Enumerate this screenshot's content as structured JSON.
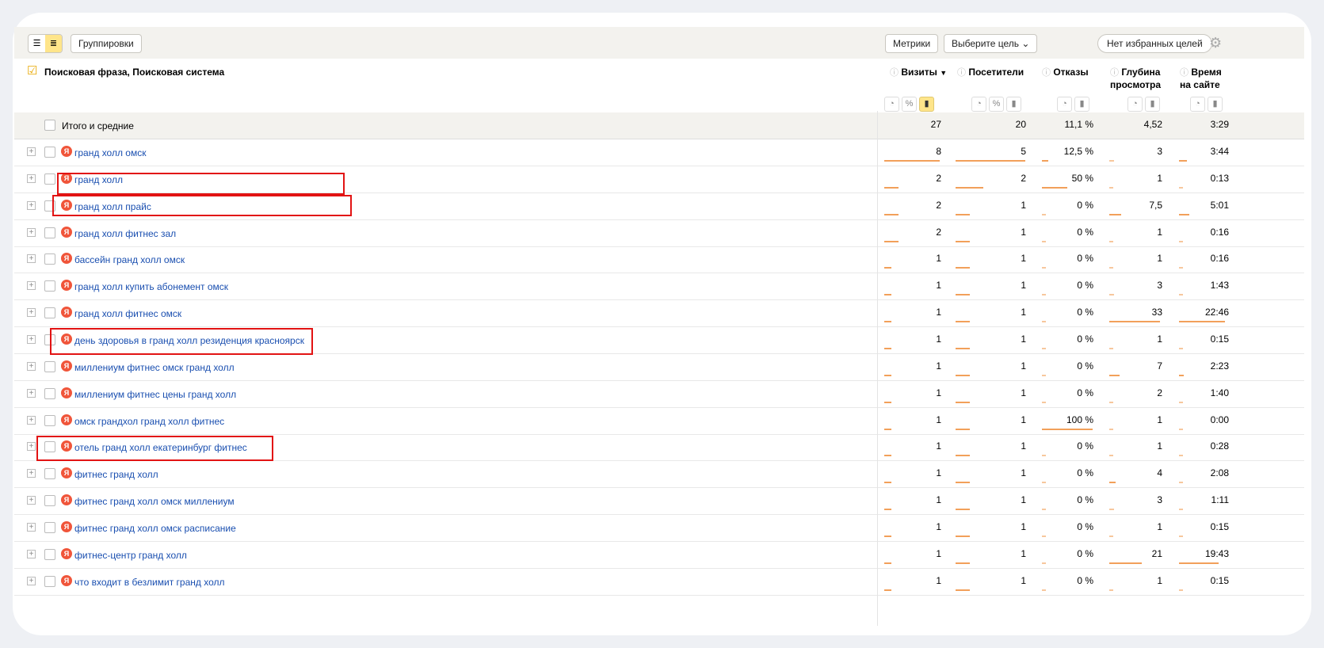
{
  "toolbar": {
    "groupings_label": "Группировки",
    "metrics_label": "Метрики",
    "goal_select_label": "Выберите цель",
    "favorites_label": "Нет избранных целей",
    "view_list_icon": "list-icon",
    "view_tree_icon": "tree-icon",
    "gear_icon": "gear-icon"
  },
  "header": {
    "dimension": "Поисковая фраза, Поисковая система",
    "columns": {
      "visits": "Визиты",
      "visitors": "Посетители",
      "bounces": "Отказы",
      "depth_1": "Глубина",
      "depth_2": "просмотра",
      "time_1": "Время",
      "time_2": "на сайте"
    },
    "sort_indicator": "▼"
  },
  "totals": {
    "label": "Итого и средние",
    "visits": "27",
    "visitors": "20",
    "bounces": "11,1 %",
    "depth": "4,52",
    "time": "3:29"
  },
  "rows": [
    {
      "phrase": "гранд холл омск",
      "visits": "8",
      "visitors": "5",
      "bounces": "12,5 %",
      "depth": "3",
      "time": "3:44",
      "f": [
        1,
        1,
        0.125,
        0.09,
        0.17
      ]
    },
    {
      "phrase": "гранд холл",
      "visits": "2",
      "visitors": "2",
      "bounces": "50 %",
      "depth": "1",
      "time": "0:13",
      "f": [
        0.25,
        0.4,
        0.5,
        0.03,
        0.01
      ]
    },
    {
      "phrase": "гранд холл прайс",
      "visits": "2",
      "visitors": "1",
      "bounces": "0 %",
      "depth": "7,5",
      "time": "5:01",
      "f": [
        0.25,
        0.2,
        0,
        0.23,
        0.22
      ]
    },
    {
      "phrase": "гранд холл фитнес зал",
      "visits": "2",
      "visitors": "1",
      "bounces": "0 %",
      "depth": "1",
      "time": "0:16",
      "f": [
        0.25,
        0.2,
        0,
        0.03,
        0.01
      ]
    },
    {
      "phrase": "бассейн гранд холл омск",
      "visits": "1",
      "visitors": "1",
      "bounces": "0 %",
      "depth": "1",
      "time": "0:16",
      "f": [
        0.13,
        0.2,
        0,
        0.03,
        0.01
      ]
    },
    {
      "phrase": "гранд холл купить абонемент омск",
      "visits": "1",
      "visitors": "1",
      "bounces": "0 %",
      "depth": "3",
      "time": "1:43",
      "f": [
        0.13,
        0.2,
        0,
        0.09,
        0.08
      ]
    },
    {
      "phrase": "гранд холл фитнес омск",
      "visits": "1",
      "visitors": "1",
      "bounces": "0 %",
      "depth": "33",
      "time": "22:46",
      "f": [
        0.13,
        0.2,
        0,
        1,
        1
      ]
    },
    {
      "phrase": "день здоровья в гранд холл резиденция красноярск",
      "visits": "1",
      "visitors": "1",
      "bounces": "0 %",
      "depth": "1",
      "time": "0:15",
      "f": [
        0.13,
        0.2,
        0,
        0.03,
        0.01
      ]
    },
    {
      "phrase": "миллениум фитнес омск гранд холл",
      "visits": "1",
      "visitors": "1",
      "bounces": "0 %",
      "depth": "7",
      "time": "2:23",
      "f": [
        0.13,
        0.2,
        0,
        0.21,
        0.1
      ]
    },
    {
      "phrase": "миллениум фитнес цены гранд холл",
      "visits": "1",
      "visitors": "1",
      "bounces": "0 %",
      "depth": "2",
      "time": "1:40",
      "f": [
        0.13,
        0.2,
        0,
        0.06,
        0.07
      ]
    },
    {
      "phrase": "омск грандхол гранд холл фитнес",
      "visits": "1",
      "visitors": "1",
      "bounces": "100 %",
      "depth": "1",
      "time": "0:00",
      "f": [
        0.13,
        0.2,
        1,
        0.03,
        0
      ]
    },
    {
      "phrase": "отель гранд холл екатеринбург фитнес",
      "visits": "1",
      "visitors": "1",
      "bounces": "0 %",
      "depth": "1",
      "time": "0:28",
      "f": [
        0.13,
        0.2,
        0,
        0.03,
        0.02
      ]
    },
    {
      "phrase": "фитнес гранд холл",
      "visits": "1",
      "visitors": "1",
      "bounces": "0 %",
      "depth": "4",
      "time": "2:08",
      "f": [
        0.13,
        0.2,
        0,
        0.12,
        0.09
      ]
    },
    {
      "phrase": "фитнес гранд холл омск миллениум",
      "visits": "1",
      "visitors": "1",
      "bounces": "0 %",
      "depth": "3",
      "time": "1:11",
      "f": [
        0.13,
        0.2,
        0,
        0.09,
        0.05
      ]
    },
    {
      "phrase": "фитнес гранд холл омск расписание",
      "visits": "1",
      "visitors": "1",
      "bounces": "0 %",
      "depth": "1",
      "time": "0:15",
      "f": [
        0.13,
        0.2,
        0,
        0.03,
        0.01
      ]
    },
    {
      "phrase": "фитнес-центр гранд холл",
      "visits": "1",
      "visitors": "1",
      "bounces": "0 %",
      "depth": "21",
      "time": "19:43",
      "f": [
        0.13,
        0.2,
        0,
        0.64,
        0.87
      ]
    },
    {
      "phrase": "что входит в безлимит гранд холл",
      "visits": "1",
      "visitors": "1",
      "bounces": "0 %",
      "depth": "1",
      "time": "0:15",
      "f": [
        0.13,
        0.2,
        0,
        0.03,
        0.01
      ]
    }
  ],
  "highlighted_rows": [
    1,
    2,
    7,
    11
  ],
  "colors": {
    "link": "#1a4fb0",
    "highlight": "#e21313",
    "bar": "#f2a05a",
    "active_toggle": "#ffe58a",
    "yandex_badge": "#f0553a"
  }
}
